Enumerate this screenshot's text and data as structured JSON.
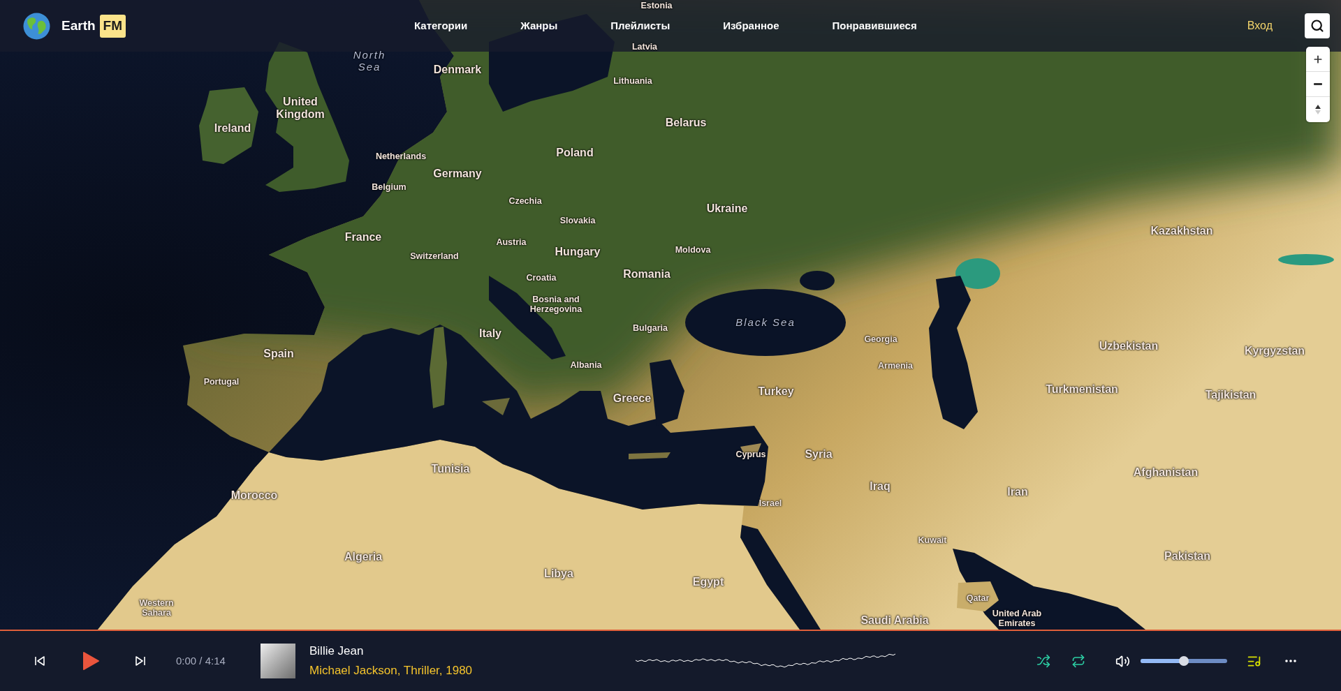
{
  "header": {
    "logo": {
      "name": "Earth",
      "badge": "FM"
    },
    "nav": [
      "Категории",
      "Жанры",
      "Плейлисты",
      "Избранное",
      "Понравившиеся"
    ],
    "login": "Вход"
  },
  "map": {
    "labels": [
      {
        "text": "Estonia",
        "kind": "country"
      },
      {
        "text": "North Sea",
        "kind": "water"
      },
      {
        "text": "Latvia",
        "kind": "country"
      },
      {
        "text": "Denmark",
        "kind": "country"
      },
      {
        "text": "Lithuania",
        "kind": "country"
      },
      {
        "text": "United Kingdom",
        "kind": "country"
      },
      {
        "text": "Ireland",
        "kind": "country"
      },
      {
        "text": "Belarus",
        "kind": "country"
      },
      {
        "text": "Netherlands",
        "kind": "country"
      },
      {
        "text": "Poland",
        "kind": "country"
      },
      {
        "text": "Germany",
        "kind": "country"
      },
      {
        "text": "Belgium",
        "kind": "country"
      },
      {
        "text": "Czechia",
        "kind": "country"
      },
      {
        "text": "Ukraine",
        "kind": "country"
      },
      {
        "text": "Slovakia",
        "kind": "country"
      },
      {
        "text": "Kazakhstan",
        "kind": "country"
      },
      {
        "text": "France",
        "kind": "country"
      },
      {
        "text": "Austria",
        "kind": "country"
      },
      {
        "text": "Switzerland",
        "kind": "country"
      },
      {
        "text": "Hungary",
        "kind": "country"
      },
      {
        "text": "Moldova",
        "kind": "country"
      },
      {
        "text": "Romania",
        "kind": "country"
      },
      {
        "text": "Croatia",
        "kind": "country"
      },
      {
        "text": "Bosnia and Herzegovina",
        "kind": "country"
      },
      {
        "text": "Black Sea",
        "kind": "water"
      },
      {
        "text": "Italy",
        "kind": "country"
      },
      {
        "text": "Bulgaria",
        "kind": "country"
      },
      {
        "text": "Georgia",
        "kind": "country"
      },
      {
        "text": "Spain",
        "kind": "country"
      },
      {
        "text": "Uzbekistan",
        "kind": "country"
      },
      {
        "text": "Kyrgyzstan",
        "kind": "country"
      },
      {
        "text": "Albania",
        "kind": "country"
      },
      {
        "text": "Armenia",
        "kind": "country"
      },
      {
        "text": "Portugal",
        "kind": "country"
      },
      {
        "text": "Greece",
        "kind": "country"
      },
      {
        "text": "Turkey",
        "kind": "country"
      },
      {
        "text": "Turkmenistan",
        "kind": "country"
      },
      {
        "text": "Tajikistan",
        "kind": "country"
      },
      {
        "text": "Cyprus",
        "kind": "country"
      },
      {
        "text": "Syria",
        "kind": "country"
      },
      {
        "text": "Tunisia",
        "kind": "country"
      },
      {
        "text": "Afghanistan",
        "kind": "country"
      },
      {
        "text": "Morocco",
        "kind": "country"
      },
      {
        "text": "Iraq",
        "kind": "country"
      },
      {
        "text": "Iran",
        "kind": "country"
      },
      {
        "text": "Israel",
        "kind": "country"
      },
      {
        "text": "Kuwait",
        "kind": "country"
      },
      {
        "text": "Algeria",
        "kind": "country"
      },
      {
        "text": "Pakistan",
        "kind": "country"
      },
      {
        "text": "Libya",
        "kind": "country"
      },
      {
        "text": "Egypt",
        "kind": "country"
      },
      {
        "text": "Western Sahara",
        "kind": "country"
      },
      {
        "text": "Qatar",
        "kind": "country"
      },
      {
        "text": "Saudi Arabia",
        "kind": "country"
      },
      {
        "text": "United Arab Emirates",
        "kind": "country"
      }
    ]
  },
  "player": {
    "playing": false,
    "time": "0:00 / 4:14",
    "title": "Billie Jean",
    "subtitle": "Michael Jackson, Thriller, 1980",
    "shuffle": {
      "on": true
    },
    "repeat": {
      "on": true
    },
    "volume": {
      "level": 0.5
    }
  }
}
